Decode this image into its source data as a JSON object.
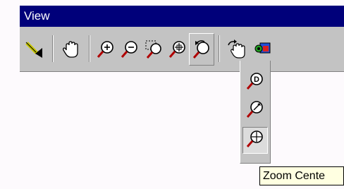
{
  "window": {
    "title": "View"
  },
  "toolbar": {
    "items": [
      {
        "icon": "select-arrow-icon"
      },
      {
        "icon": "pan-hand-icon"
      },
      {
        "icon": "zoom-in-icon"
      },
      {
        "icon": "zoom-out-icon"
      },
      {
        "icon": "zoom-window-icon"
      },
      {
        "icon": "zoom-all-icon"
      },
      {
        "icon": "zoom-previous-icon"
      },
      {
        "icon": "rotate-hand-icon"
      },
      {
        "icon": "color-render-icon"
      }
    ]
  },
  "flyout": {
    "items": [
      {
        "icon": "zoom-dynamic-icon"
      },
      {
        "icon": "zoom-scale-icon"
      },
      {
        "icon": "zoom-center-icon",
        "active": true
      }
    ]
  },
  "tooltip": {
    "text": "Zoom Cente"
  },
  "colors": {
    "titlebar": "#00007a",
    "face": "#c3c3c3",
    "tooltip": "#ffffe1",
    "icon_red": "#b00000"
  }
}
